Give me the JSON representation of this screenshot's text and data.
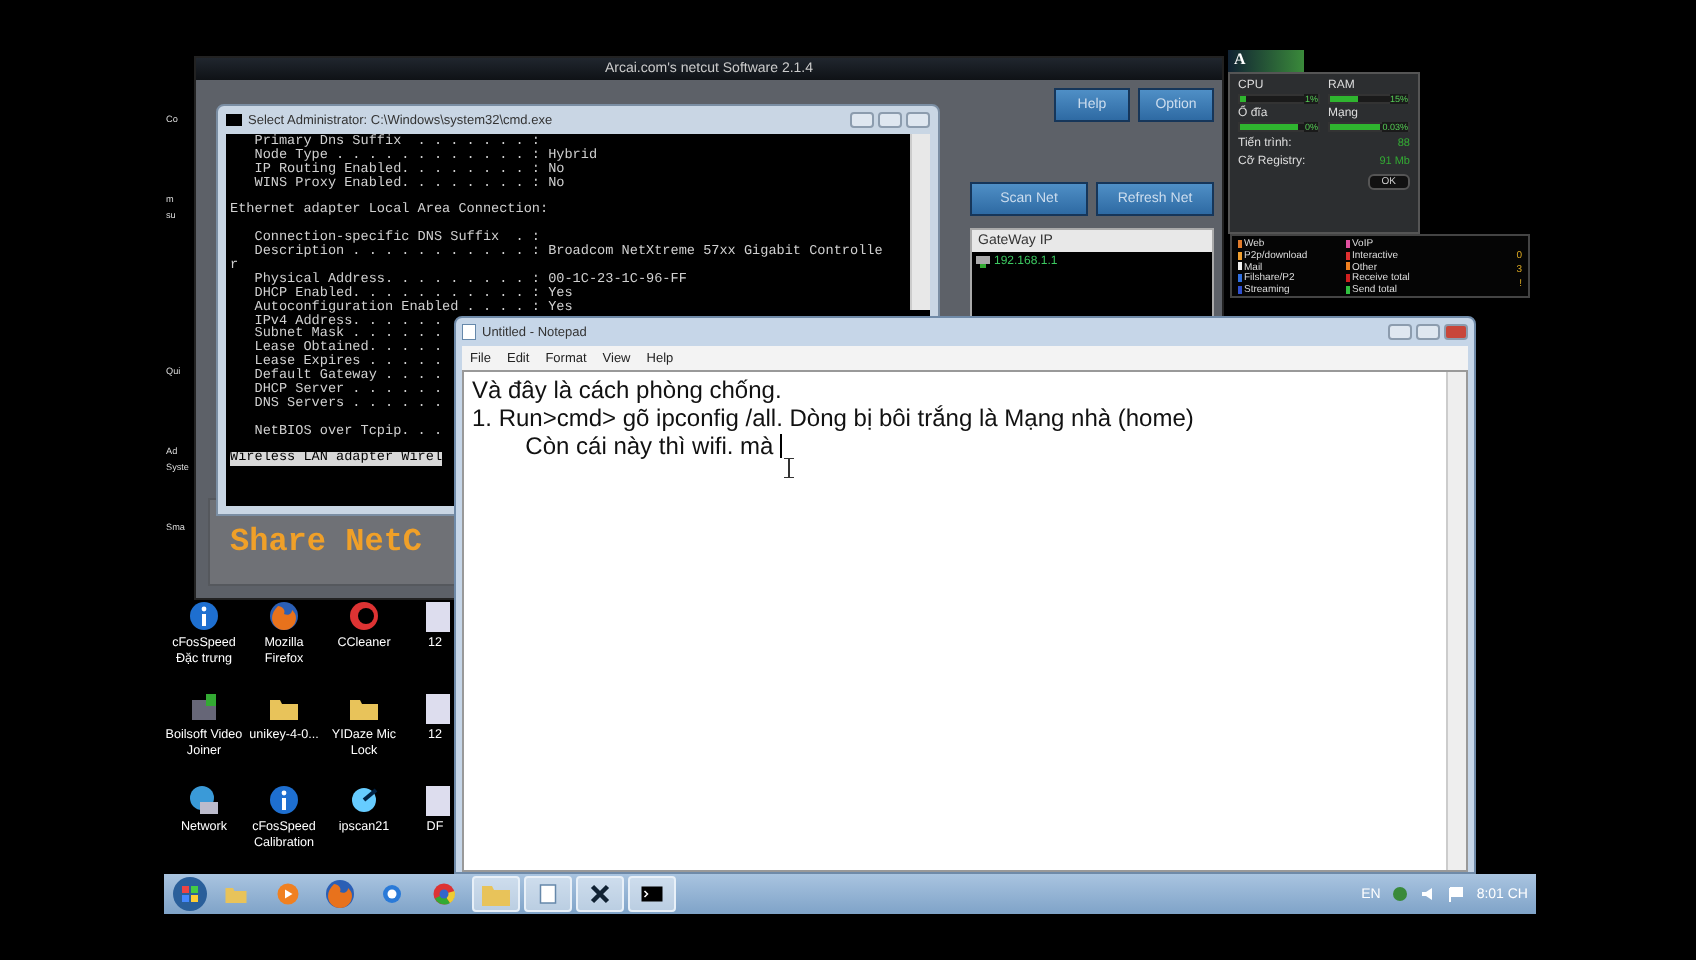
{
  "desktop_edge_labels": [
    {
      "lines": [
        "Co"
      ]
    },
    {
      "lines": [
        "m",
        "su"
      ]
    },
    {
      "lines": [
        "Qui"
      ]
    },
    {
      "lines": [
        "Ad",
        "Syste"
      ]
    },
    {
      "lines": [
        "Sma"
      ]
    }
  ],
  "netcut": {
    "title": "Arcai.com's netcut Software 2.1.4",
    "top_buttons": [
      "Help",
      "Option"
    ],
    "scan_buttons": [
      "Scan Net",
      "Refresh Net"
    ],
    "list": {
      "columns": [
        "GateWay IP"
      ],
      "rows": [
        {
          "ip": "192.168.1.1"
        }
      ]
    },
    "banner": "Share NetC"
  },
  "cmd": {
    "title": "Select Administrator: C:\\Windows\\system32\\cmd.exe",
    "lines": [
      {
        "kind": "line",
        "text": "   Primary Dns Suffix  . . . . . . . :"
      },
      {
        "kind": "line",
        "text": "   Node Type . . . . . . . . . . . . : Hybrid"
      },
      {
        "kind": "line",
        "text": "   IP Routing Enabled. . . . . . . . : No"
      },
      {
        "kind": "line",
        "text": "   WINS Proxy Enabled. . . . . . . . : No"
      },
      {
        "kind": "blank"
      },
      {
        "kind": "line",
        "text": "Ethernet adapter Local Area Connection:"
      },
      {
        "kind": "blank"
      },
      {
        "kind": "line",
        "text": "   Connection-specific DNS Suffix  . :"
      },
      {
        "kind": "line",
        "text": "   Description . . . . . . . . . . . : Broadcom NetXtreme 57xx Gigabit Controlle"
      },
      {
        "kind": "line",
        "text": "r"
      },
      {
        "kind": "line",
        "text": "   Physical Address. . . . . . . . . : 00-1C-23-1C-96-FF"
      },
      {
        "kind": "line",
        "text": "   DHCP Enabled. . . . . . . . . . . : Yes"
      },
      {
        "kind": "line",
        "text": "   Autoconfiguration Enabled . . . . : Yes"
      },
      {
        "kind": "line",
        "text": "   IPv4 Address. . . . . ."
      },
      {
        "kind": "line",
        "text": "   Subnet Mask . . . . . ."
      },
      {
        "kind": "line",
        "text": "   Lease Obtained. . . . ."
      },
      {
        "kind": "line",
        "text": "   Lease Expires . . . . ."
      },
      {
        "kind": "line",
        "text": "   Default Gateway . . . ."
      },
      {
        "kind": "line",
        "text": "   DHCP Server . . . . . ."
      },
      {
        "kind": "line",
        "text": "   DNS Servers . . . . . ."
      },
      {
        "kind": "blank"
      },
      {
        "kind": "line",
        "text": "   NetBIOS over Tcpip. . ."
      },
      {
        "kind": "blank"
      },
      {
        "kind": "highlight",
        "text": "Wireless LAN adapter Wirel"
      }
    ]
  },
  "monitor_gadget": {
    "header": "A",
    "meters": [
      {
        "label": "CPU",
        "reading": "1%",
        "level": 0.08
      },
      {
        "label": "RAM",
        "reading": "15%",
        "level": 0.35
      },
      {
        "label": "Ổ đĩa",
        "reading": "0%",
        "level": 0.75
      },
      {
        "label": "Mạng",
        "reading": "0.03%",
        "level": 0.65
      }
    ],
    "stats": [
      {
        "label": "Tiến trình:",
        "value": "88"
      },
      {
        "label": "Cỡ Registry:",
        "value": "91 Mb"
      }
    ],
    "button": "OK"
  },
  "traffic_legend": {
    "items": [
      {
        "label": "Web",
        "color": "#e07a2a"
      },
      {
        "label": "VoIP",
        "color": "#e050a0"
      },
      {
        "label": "P2p/download",
        "color": "#f0a030"
      },
      {
        "label": "Interactive",
        "color": "#e03030"
      },
      {
        "label": "Mail",
        "color": "#f0f0f0"
      },
      {
        "label": "Other",
        "color": "#f08020"
      },
      {
        "label": "Filshare/P2",
        "color": "#3070e0"
      },
      {
        "label": "Receive total",
        "color": "#d02020"
      },
      {
        "label": "Streaming",
        "color": "#3050d0"
      },
      {
        "label": "Send total",
        "color": "#30c040"
      }
    ],
    "values": [
      "0",
      "3",
      "!"
    ]
  },
  "desktop_icons": [
    {
      "label": "cFosSpeed Đặc trưng",
      "kind": "info"
    },
    {
      "label": "Mozilla Firefox",
      "kind": "firefox"
    },
    {
      "label": "CCleaner",
      "kind": "ccleaner"
    },
    {
      "label": "Boilsoft Video Joiner",
      "kind": "app"
    },
    {
      "label": "unikey-4-0...",
      "kind": "folder"
    },
    {
      "label": "YIDaze Mic Lock",
      "kind": "folder"
    },
    {
      "label": "Network",
      "kind": "network"
    },
    {
      "label": "cFosSpeed Calibration",
      "kind": "info"
    },
    {
      "label": "ipscan21",
      "kind": "scanner"
    }
  ],
  "partial_icons": [
    {
      "label": "12"
    },
    {
      "label": "12"
    },
    {
      "label": "DF"
    }
  ],
  "notepad": {
    "title": "Untitled - Notepad",
    "menu": [
      "File",
      "Edit",
      "Format",
      "View",
      "Help"
    ],
    "lines": [
      "Và đây là cách phòng chống.",
      "1. Run>cmd> gõ ipconfig /all. Dòng bị bôi trắng là Mạng nhà (home)",
      "\t\tCòn cái này thì wifi. mà "
    ]
  },
  "taskbar": {
    "items": [
      {
        "kind": "explorer",
        "selected": false
      },
      {
        "kind": "media",
        "selected": false
      },
      {
        "kind": "firefox",
        "selected": false
      },
      {
        "kind": "ie",
        "selected": false
      },
      {
        "kind": "chrome",
        "selected": false
      },
      {
        "kind": "folder",
        "selected": true
      },
      {
        "kind": "notepad",
        "selected": true
      },
      {
        "kind": "netcut",
        "selected": true
      },
      {
        "kind": "cmd",
        "selected": true
      }
    ],
    "language": "EN",
    "clock": "8:01 CH"
  }
}
